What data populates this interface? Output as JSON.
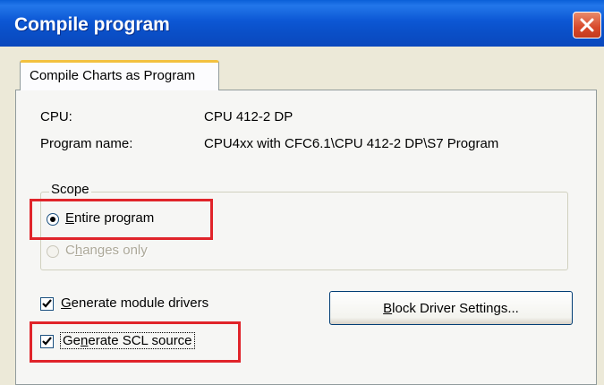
{
  "window": {
    "title": "Compile program",
    "close_icon": "close-icon"
  },
  "tab": {
    "label": "Compile Charts as Program"
  },
  "info": {
    "cpu_label": "CPU:",
    "cpu_value": "CPU 412-2 DP",
    "program_label": "Program name:",
    "program_value": "CPU4xx with CFC6.1\\CPU 412-2 DP\\S7 Program"
  },
  "scope": {
    "legend": "Scope",
    "entire_program": {
      "mnemonic": "E",
      "rest": "ntire program",
      "selected": true
    },
    "changes_only": {
      "pre": "C",
      "mnemonic": "h",
      "rest": "anges only",
      "enabled": false
    }
  },
  "options": {
    "module_drivers": {
      "mnemonic": "G",
      "rest": "enerate module drivers",
      "checked": true
    },
    "scl_source": {
      "pre": "Ge",
      "mnemonic": "n",
      "rest": "erate SCL source",
      "checked": true
    }
  },
  "buttons": {
    "block_driver": {
      "mnemonic": "B",
      "rest": "lock Driver Settings..."
    }
  },
  "colors": {
    "titlebar": "#0a4fc7",
    "highlight": "#e0242a",
    "dialog_bg": "#ece9d8",
    "disabled_text": "#aca899"
  }
}
